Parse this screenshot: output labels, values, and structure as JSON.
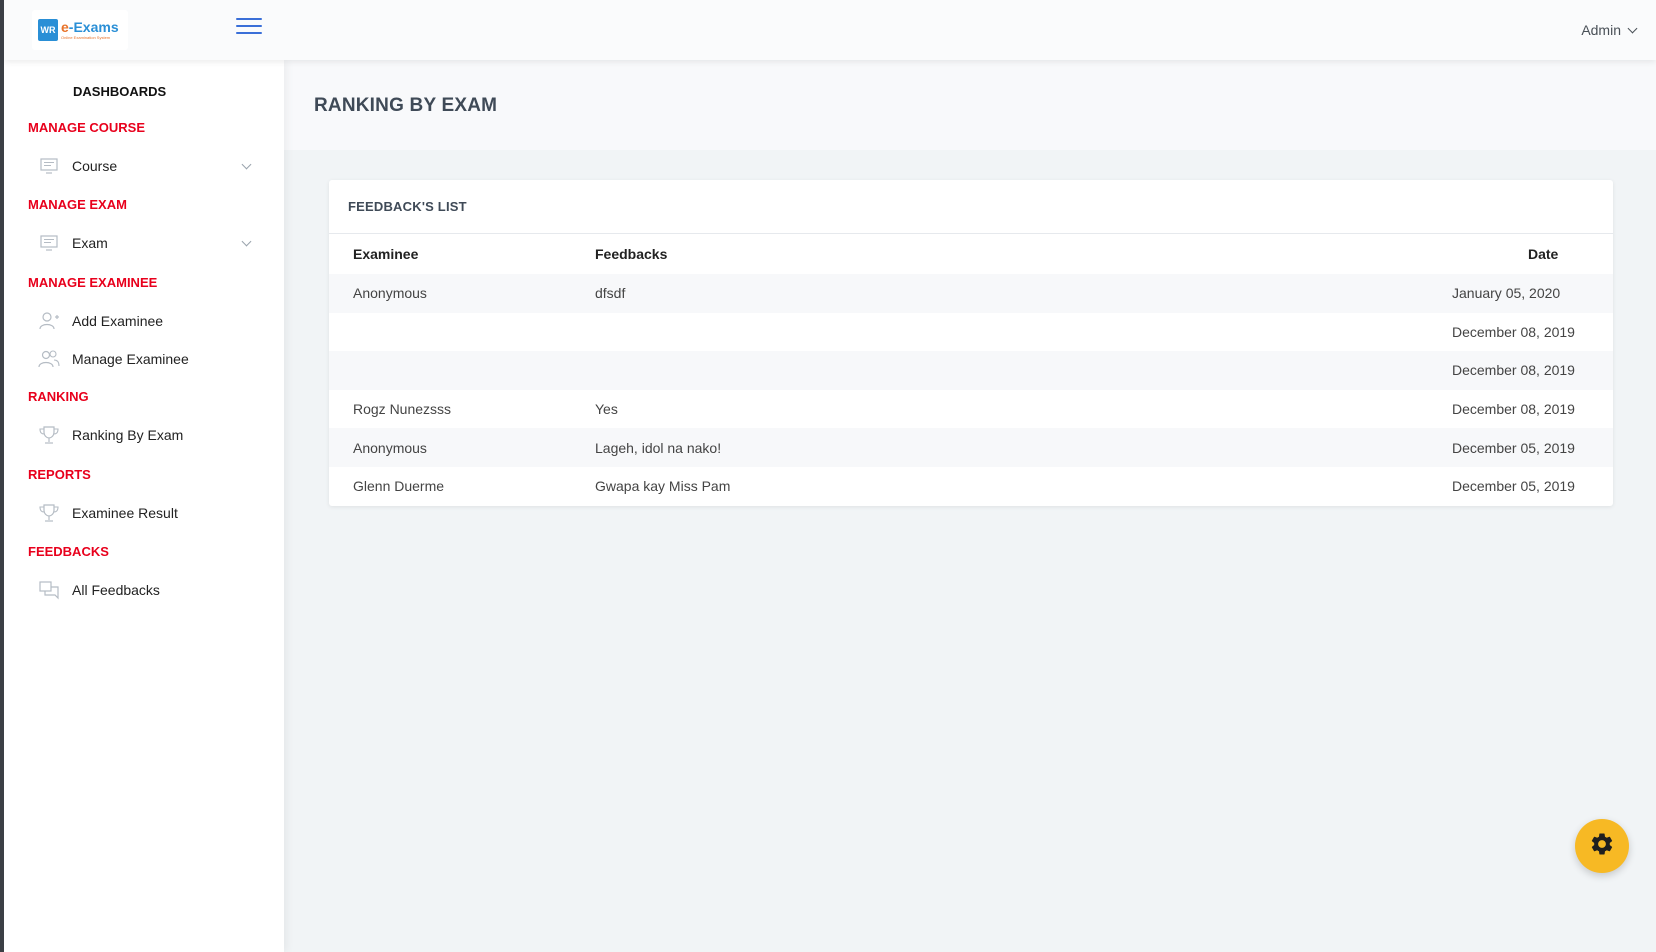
{
  "header": {
    "logo": {
      "badge": "WR",
      "prefix": "e",
      "text": "-Exams",
      "tagline": "Online Examination System"
    },
    "user_name": "Admin"
  },
  "sidebar": {
    "dashboard_label": "DASHBOARDS",
    "sections": [
      {
        "heading": "MANAGE COURSE",
        "items": [
          {
            "label": "Course",
            "icon": "monitor-icon",
            "expandable": true
          }
        ]
      },
      {
        "heading": "MANAGE EXAM",
        "items": [
          {
            "label": "Exam",
            "icon": "monitor-icon",
            "expandable": true
          }
        ]
      },
      {
        "heading": "MANAGE EXAMINEE",
        "items": [
          {
            "label": "Add Examinee",
            "icon": "add-user-icon"
          },
          {
            "label": "Manage Examinee",
            "icon": "users-icon"
          }
        ]
      },
      {
        "heading": "RANKING",
        "items": [
          {
            "label": "Ranking By Exam",
            "icon": "trophy-icon"
          }
        ]
      },
      {
        "heading": "REPORTS",
        "items": [
          {
            "label": "Examinee Result",
            "icon": "trophy-icon"
          }
        ]
      },
      {
        "heading": "FEEDBACKS",
        "items": [
          {
            "label": "All Feedbacks",
            "icon": "chat-icon"
          }
        ]
      }
    ]
  },
  "main": {
    "page_title": "RANKING BY EXAM",
    "card_title": "FEEDBACK'S LIST",
    "table": {
      "columns": [
        "Examinee",
        "Feedbacks",
        "Date"
      ],
      "rows": [
        {
          "examinee": "Anonymous",
          "feedback": "dfsdf",
          "date": "January 05, 2020"
        },
        {
          "examinee": "",
          "feedback": "",
          "date": "December 08, 2019"
        },
        {
          "examinee": "",
          "feedback": "",
          "date": "December 08, 2019"
        },
        {
          "examinee": "Rogz Nunezsss",
          "feedback": "Yes",
          "date": "December 08, 2019"
        },
        {
          "examinee": "Anonymous",
          "feedback": "Lageh, idol na nako!",
          "date": "December 05, 2019"
        },
        {
          "examinee": "Glenn Duerme",
          "feedback": "Gwapa kay Miss Pam",
          "date": "December 05, 2019"
        }
      ]
    }
  },
  "colors": {
    "accent_red": "#e8001c",
    "menu_blue": "#3a6fd8",
    "fab_yellow": "#f7b924"
  }
}
